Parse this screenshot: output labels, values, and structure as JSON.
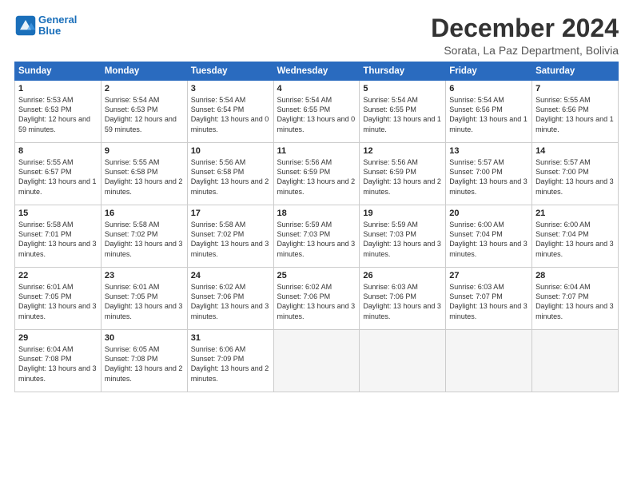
{
  "logo": {
    "line1": "General",
    "line2": "Blue"
  },
  "title": "December 2024",
  "subtitle": "Sorata, La Paz Department, Bolivia",
  "days_header": [
    "Sunday",
    "Monday",
    "Tuesday",
    "Wednesday",
    "Thursday",
    "Friday",
    "Saturday"
  ],
  "weeks": [
    [
      {
        "day": "1",
        "sunrise": "5:53 AM",
        "sunset": "6:53 PM",
        "daylight": "12 hours and 59 minutes."
      },
      {
        "day": "2",
        "sunrise": "5:54 AM",
        "sunset": "6:53 PM",
        "daylight": "12 hours and 59 minutes."
      },
      {
        "day": "3",
        "sunrise": "5:54 AM",
        "sunset": "6:54 PM",
        "daylight": "13 hours and 0 minutes."
      },
      {
        "day": "4",
        "sunrise": "5:54 AM",
        "sunset": "6:55 PM",
        "daylight": "13 hours and 0 minutes."
      },
      {
        "day": "5",
        "sunrise": "5:54 AM",
        "sunset": "6:55 PM",
        "daylight": "13 hours and 1 minute."
      },
      {
        "day": "6",
        "sunrise": "5:54 AM",
        "sunset": "6:56 PM",
        "daylight": "13 hours and 1 minute."
      },
      {
        "day": "7",
        "sunrise": "5:55 AM",
        "sunset": "6:56 PM",
        "daylight": "13 hours and 1 minute."
      }
    ],
    [
      {
        "day": "8",
        "sunrise": "5:55 AM",
        "sunset": "6:57 PM",
        "daylight": "13 hours and 1 minute."
      },
      {
        "day": "9",
        "sunrise": "5:55 AM",
        "sunset": "6:58 PM",
        "daylight": "13 hours and 2 minutes."
      },
      {
        "day": "10",
        "sunrise": "5:56 AM",
        "sunset": "6:58 PM",
        "daylight": "13 hours and 2 minutes."
      },
      {
        "day": "11",
        "sunrise": "5:56 AM",
        "sunset": "6:59 PM",
        "daylight": "13 hours and 2 minutes."
      },
      {
        "day": "12",
        "sunrise": "5:56 AM",
        "sunset": "6:59 PM",
        "daylight": "13 hours and 2 minutes."
      },
      {
        "day": "13",
        "sunrise": "5:57 AM",
        "sunset": "7:00 PM",
        "daylight": "13 hours and 3 minutes."
      },
      {
        "day": "14",
        "sunrise": "5:57 AM",
        "sunset": "7:00 PM",
        "daylight": "13 hours and 3 minutes."
      }
    ],
    [
      {
        "day": "15",
        "sunrise": "5:58 AM",
        "sunset": "7:01 PM",
        "daylight": "13 hours and 3 minutes."
      },
      {
        "day": "16",
        "sunrise": "5:58 AM",
        "sunset": "7:02 PM",
        "daylight": "13 hours and 3 minutes."
      },
      {
        "day": "17",
        "sunrise": "5:58 AM",
        "sunset": "7:02 PM",
        "daylight": "13 hours and 3 minutes."
      },
      {
        "day": "18",
        "sunrise": "5:59 AM",
        "sunset": "7:03 PM",
        "daylight": "13 hours and 3 minutes."
      },
      {
        "day": "19",
        "sunrise": "5:59 AM",
        "sunset": "7:03 PM",
        "daylight": "13 hours and 3 minutes."
      },
      {
        "day": "20",
        "sunrise": "6:00 AM",
        "sunset": "7:04 PM",
        "daylight": "13 hours and 3 minutes."
      },
      {
        "day": "21",
        "sunrise": "6:00 AM",
        "sunset": "7:04 PM",
        "daylight": "13 hours and 3 minutes."
      }
    ],
    [
      {
        "day": "22",
        "sunrise": "6:01 AM",
        "sunset": "7:05 PM",
        "daylight": "13 hours and 3 minutes."
      },
      {
        "day": "23",
        "sunrise": "6:01 AM",
        "sunset": "7:05 PM",
        "daylight": "13 hours and 3 minutes."
      },
      {
        "day": "24",
        "sunrise": "6:02 AM",
        "sunset": "7:06 PM",
        "daylight": "13 hours and 3 minutes."
      },
      {
        "day": "25",
        "sunrise": "6:02 AM",
        "sunset": "7:06 PM",
        "daylight": "13 hours and 3 minutes."
      },
      {
        "day": "26",
        "sunrise": "6:03 AM",
        "sunset": "7:06 PM",
        "daylight": "13 hours and 3 minutes."
      },
      {
        "day": "27",
        "sunrise": "6:03 AM",
        "sunset": "7:07 PM",
        "daylight": "13 hours and 3 minutes."
      },
      {
        "day": "28",
        "sunrise": "6:04 AM",
        "sunset": "7:07 PM",
        "daylight": "13 hours and 3 minutes."
      }
    ],
    [
      {
        "day": "29",
        "sunrise": "6:04 AM",
        "sunset": "7:08 PM",
        "daylight": "13 hours and 3 minutes."
      },
      {
        "day": "30",
        "sunrise": "6:05 AM",
        "sunset": "7:08 PM",
        "daylight": "13 hours and 2 minutes."
      },
      {
        "day": "31",
        "sunrise": "6:06 AM",
        "sunset": "7:09 PM",
        "daylight": "13 hours and 2 minutes."
      },
      null,
      null,
      null,
      null
    ]
  ]
}
